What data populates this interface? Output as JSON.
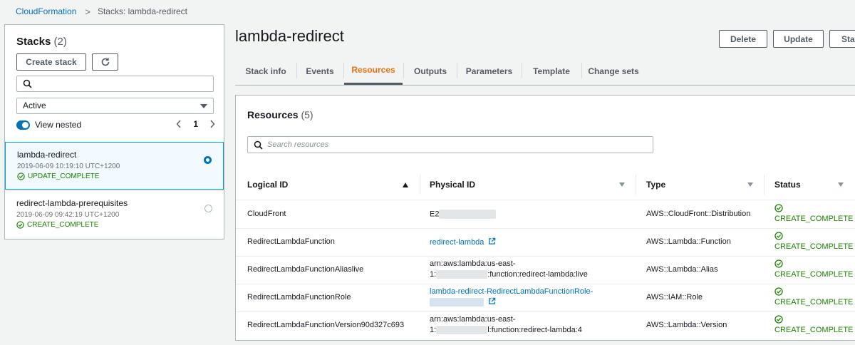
{
  "breadcrumb": {
    "root": "CloudFormation",
    "separator": ">",
    "current": "Stacks: lambda-redirect"
  },
  "sidebar": {
    "title": "Stacks",
    "count": "(2)",
    "create_button": "Create stack",
    "filter_value": "Active",
    "view_nested_label": "View nested",
    "page": "1",
    "stacks": [
      {
        "name": "lambda-redirect",
        "date": "2019-06-09 10:19:10 UTC+1200",
        "status": "UPDATE_COMPLETE",
        "selected": true
      },
      {
        "name": "redirect-lambda-prerequisites",
        "date": "2019-06-09 09:42:19 UTC+1200",
        "status": "CREATE_COMPLETE",
        "selected": false
      }
    ]
  },
  "main": {
    "title": "lambda-redirect",
    "buttons": {
      "delete": "Delete",
      "update": "Update",
      "stack_actions": "Stac"
    },
    "tabs": [
      "Stack info",
      "Events",
      "Resources",
      "Outputs",
      "Parameters",
      "Template",
      "Change sets"
    ],
    "active_tab": "Resources"
  },
  "resources": {
    "title": "Resources",
    "count": "(5)",
    "search_placeholder": "Search resources",
    "columns": [
      "Logical ID",
      "Physical ID",
      "Type",
      "Status"
    ],
    "rows": [
      {
        "logical_id": "CloudFront",
        "physical_line1": "E2",
        "physical_line2": "",
        "physical_link": false,
        "type": "AWS::CloudFront::Distribution",
        "status": "CREATE_COMPLETE"
      },
      {
        "logical_id": "RedirectLambdaFunction",
        "physical_line1": "redirect-lambda",
        "physical_line2": "",
        "physical_link": true,
        "type": "AWS::Lambda::Function",
        "status": "CREATE_COMPLETE"
      },
      {
        "logical_id": "RedirectLambdaFunctionAliaslive",
        "physical_line1": "arn:aws:lambda:us-east-",
        "physical_line2": ":function:redirect-lambda:live",
        "physical_link": false,
        "type": "AWS::Lambda::Alias",
        "status": "CREATE_COMPLETE"
      },
      {
        "logical_id": "RedirectLambdaFunctionRole",
        "physical_line1": "lambda-redirect-RedirectLambdaFunctionRole-",
        "physical_line2": "",
        "physical_link": true,
        "type": "AWS::IAM::Role",
        "status": "CREATE_COMPLETE"
      },
      {
        "logical_id": "RedirectLambdaFunctionVersion90d327c693",
        "physical_line1": "arn:aws:lambda:us-east-",
        "physical_line2": "l:function:redirect-lambda:4",
        "physical_link": false,
        "type": "AWS::Lambda::Version",
        "status": "CREATE_COMPLETE"
      }
    ]
  },
  "colors": {
    "link": "#0073bb",
    "success": "#1d8102",
    "active_tab": "#ec7211"
  }
}
